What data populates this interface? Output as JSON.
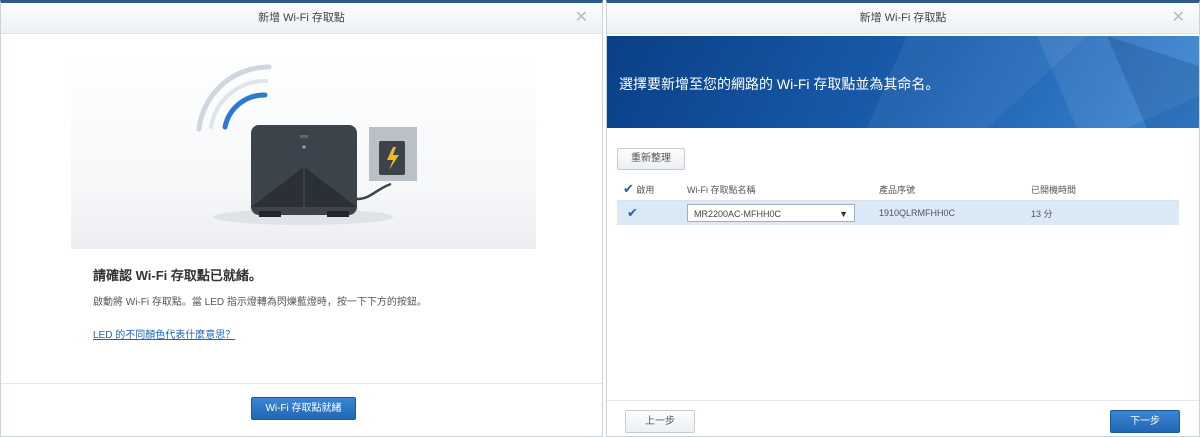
{
  "left_dialog": {
    "title": "新增 Wi-Fi 存取點",
    "heading": "請確認 Wi-Fi 存取點已就緒。",
    "description": "啟動將 Wi-Fi 存取點。當 LED 指示燈轉為閃爍藍燈時，按一下下方的按鈕。",
    "link": "LED 的不同顏色代表什麼意思？",
    "ready_button": "Wi-Fi 存取點就緒"
  },
  "right_dialog": {
    "title": "新增 Wi-Fi 存取點",
    "banner_text": "選擇要新增至您的網路的 Wi-Fi 存取點並為其命名。",
    "rescan_button": "重新整理",
    "table": {
      "columns": [
        "啟用",
        "Wi-Fi 存取點名稱",
        "產品序號",
        "已開機時間"
      ],
      "rows": [
        {
          "enabled": true,
          "name": "MR2200AC-MFHH0C",
          "serial": "1910QLRMFHH0C",
          "uptime": "13 分"
        }
      ]
    },
    "back_button": "上一步",
    "next_button": "下一步"
  },
  "icons": {
    "close": "close-icon",
    "check": "check-icon",
    "dropdown": "chevron-down-icon",
    "wifi": "wifi-signal-icon",
    "router": "router-icon",
    "plug": "power-plug-icon"
  },
  "colors": {
    "accent": "#2266b5",
    "banner": "#1a5fae",
    "selected_row": "#dbe8f5"
  }
}
